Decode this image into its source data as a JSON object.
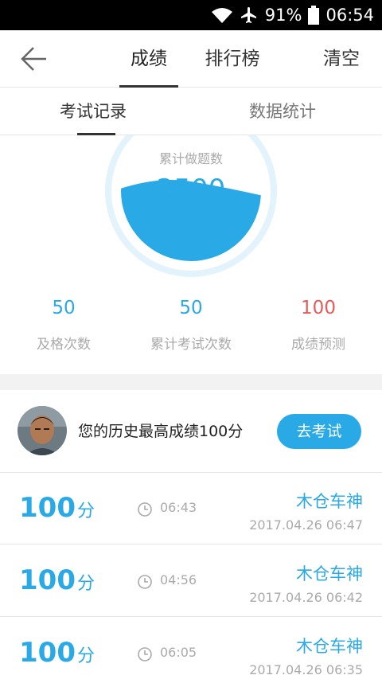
{
  "status_bar": {
    "battery": "91%",
    "time": "06:54"
  },
  "nav": {
    "tabs": [
      {
        "label": "成绩"
      },
      {
        "label": "排行榜"
      }
    ],
    "clear_label": "清空"
  },
  "subtabs": [
    {
      "label": "考试记录"
    },
    {
      "label": "数据统计"
    }
  ],
  "summary": {
    "gauge_label": "累计做题数",
    "gauge_value": "2500",
    "stats": [
      {
        "value": "50",
        "label": "及格次数"
      },
      {
        "value": "50",
        "label": "累计考试次数"
      },
      {
        "value": "100",
        "label": "成绩预测"
      }
    ]
  },
  "best": {
    "text": "您的历史最高成绩100分",
    "button_label": "去考试"
  },
  "records": [
    {
      "score": "100",
      "unit": "分",
      "duration": "06:43",
      "user": "木仓车神",
      "date": "2017.04.26  06:47"
    },
    {
      "score": "100",
      "unit": "分",
      "duration": "04:56",
      "user": "木仓车神",
      "date": "2017.04.26  06:42"
    },
    {
      "score": "100",
      "unit": "分",
      "duration": "06:05",
      "user": "木仓车神",
      "date": "2017.04.26  06:35"
    }
  ],
  "colors": {
    "accent": "#29a9e6",
    "predict": "#e85a5a",
    "muted": "#aaaaaa"
  }
}
